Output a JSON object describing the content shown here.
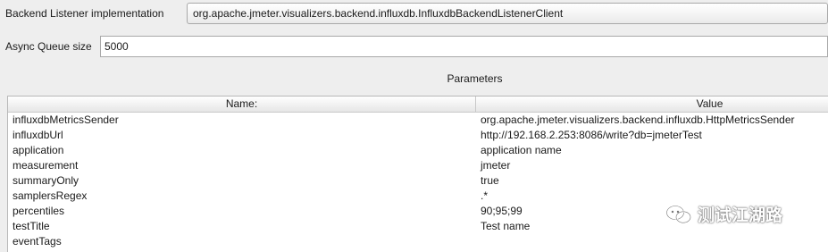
{
  "backend_listener": {
    "label": "Backend Listener implementation",
    "selected": "org.apache.jmeter.visualizers.backend.influxdb.InfluxdbBackendListenerClient"
  },
  "async_queue": {
    "label": "Async Queue size",
    "value": "5000"
  },
  "parameters": {
    "title": "Parameters",
    "columns": {
      "name": "Name:",
      "value": "Value"
    },
    "rows": [
      {
        "name": "influxdbMetricsSender",
        "value": "org.apache.jmeter.visualizers.backend.influxdb.HttpMetricsSender"
      },
      {
        "name": "influxdbUrl",
        "value": "http://192.168.2.253:8086/write?db=jmeterTest"
      },
      {
        "name": "application",
        "value": "application name"
      },
      {
        "name": "measurement",
        "value": "jmeter"
      },
      {
        "name": "summaryOnly",
        "value": "true"
      },
      {
        "name": "samplersRegex",
        "value": ".*"
      },
      {
        "name": "percentiles",
        "value": "90;95;99"
      },
      {
        "name": "testTitle",
        "value": "Test name"
      },
      {
        "name": "eventTags",
        "value": ""
      }
    ]
  },
  "watermark": {
    "text": "测试江湖路",
    "icon": "wechat-icon"
  }
}
